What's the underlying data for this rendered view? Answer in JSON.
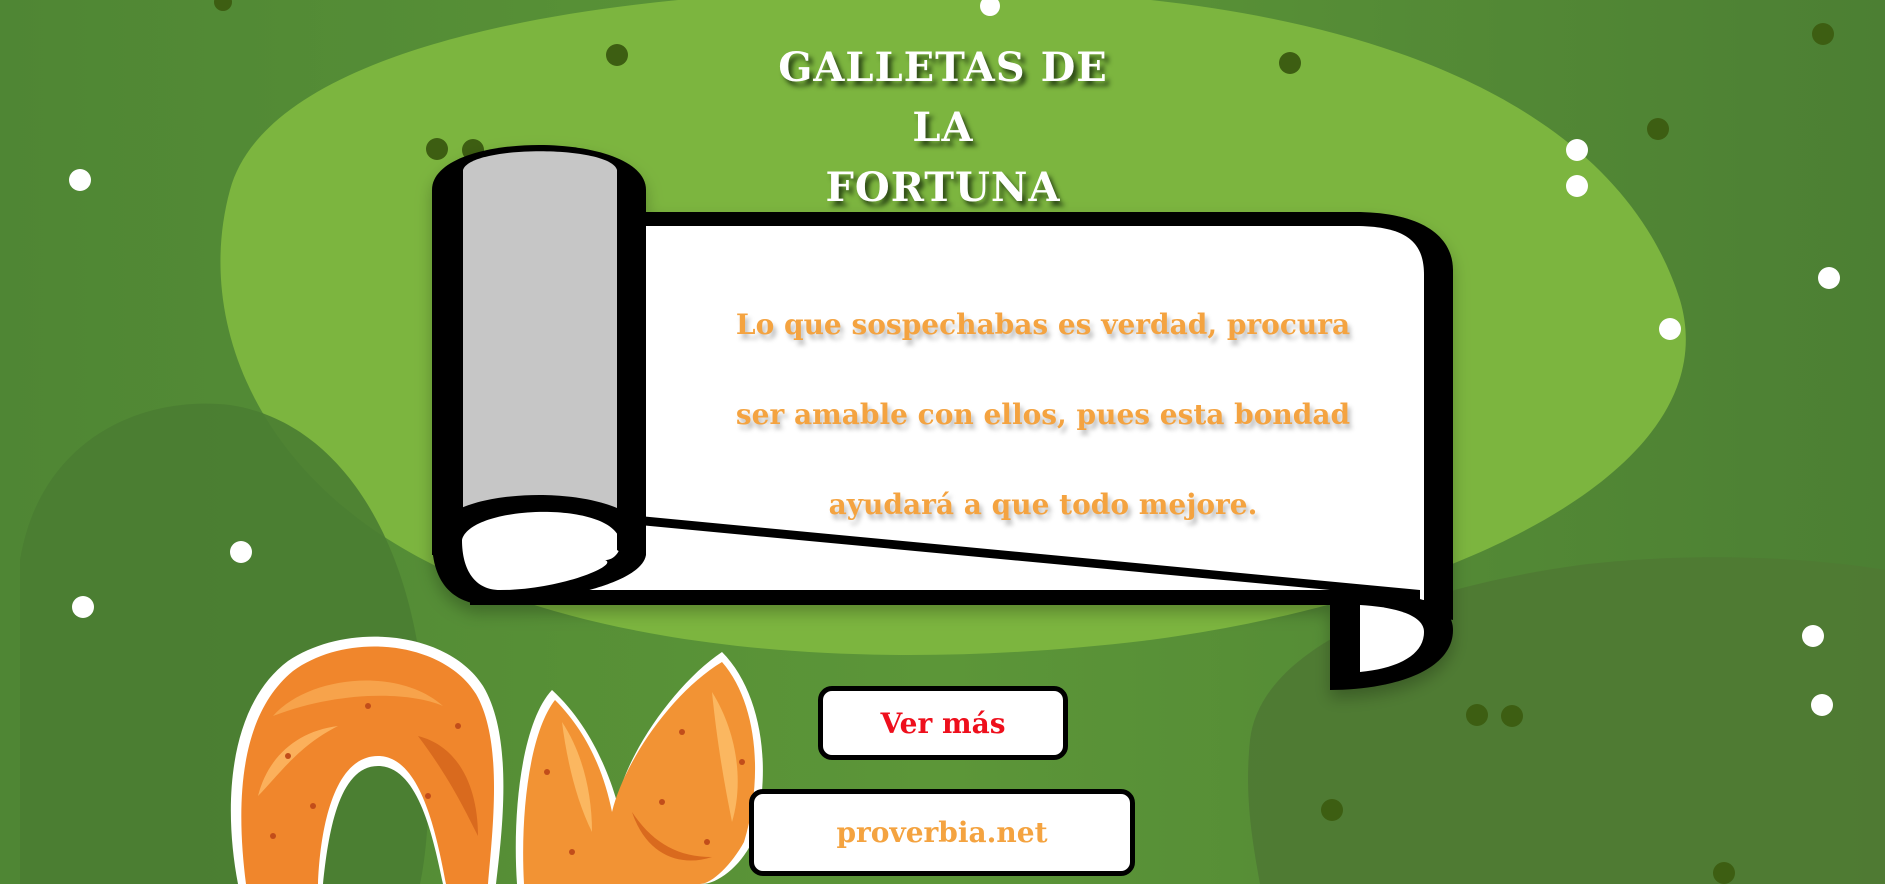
{
  "header": {
    "title_line1": "GALLETAS DE LA",
    "title_line2": "FORTUNA"
  },
  "fortune": {
    "line1": "Lo que sospechabas es verdad, procura",
    "line2": "ser amable con ellos, pues esta bondad",
    "line3": "ayudará a que todo mejore."
  },
  "buttons": {
    "more_label": "Ver más",
    "site_label": "proverbia.net"
  },
  "colors": {
    "background_dark": "#4f8633",
    "background_light": "#7db63f",
    "title_text": "#ffffff",
    "fortune_text": "#f4a340",
    "more_button_text": "#ee0f1c",
    "site_button_text": "#f4a340"
  },
  "icons": {
    "scroll": "paper-scroll-icon",
    "cookie_left": "fortune-cookie-icon",
    "cookie_right": "fortune-cookie-icon"
  }
}
